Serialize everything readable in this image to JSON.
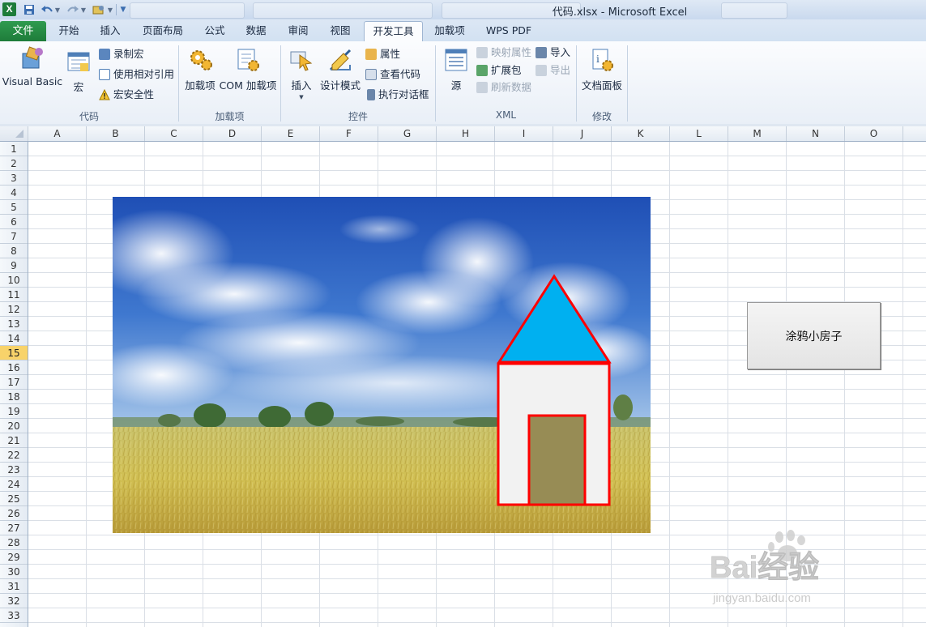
{
  "window": {
    "title": "代码.xlsx - Microsoft Excel"
  },
  "ribbon_tabs": [
    {
      "label": "文件"
    },
    {
      "label": "开始"
    },
    {
      "label": "插入"
    },
    {
      "label": "页面布局"
    },
    {
      "label": "公式"
    },
    {
      "label": "数据"
    },
    {
      "label": "审阅"
    },
    {
      "label": "视图"
    },
    {
      "label": "开发工具",
      "active": true
    },
    {
      "label": "加载项"
    },
    {
      "label": "WPS PDF"
    }
  ],
  "groups": {
    "code": {
      "label": "代码",
      "visual_basic": "Visual Basic",
      "macros": "宏",
      "record_macro": "录制宏",
      "use_relative_refs": "使用相对引用",
      "macro_security": "宏安全性"
    },
    "addins": {
      "label": "加载项",
      "addins_btn": "加载项",
      "com_addins": "COM 加载项"
    },
    "controls": {
      "label": "控件",
      "insert": "插入",
      "design_mode": "设计模式",
      "properties": "属性",
      "view_code": "查看代码",
      "run_dialog": "执行对话框"
    },
    "xml": {
      "label": "XML",
      "source": "源",
      "map_properties": "映射属性",
      "expansion_packs": "扩展包",
      "refresh_data": "刷新数据",
      "import": "导入",
      "export": "导出"
    },
    "modify": {
      "label": "修改",
      "document_panel": "文档面板"
    }
  },
  "sheet": {
    "columns": [
      "A",
      "B",
      "C",
      "D",
      "E",
      "F",
      "G",
      "H",
      "I",
      "J",
      "K",
      "L",
      "M",
      "N",
      "O"
    ],
    "rows": [
      "1",
      "2",
      "3",
      "4",
      "5",
      "6",
      "7",
      "8",
      "9",
      "10",
      "11",
      "12",
      "13",
      "14",
      "15",
      "16",
      "17",
      "18",
      "19",
      "20",
      "21",
      "22",
      "23",
      "24",
      "25",
      "26",
      "27",
      "28",
      "29",
      "30",
      "31",
      "32",
      "33"
    ],
    "active_row": "15",
    "macro_button_label": "涂鸦小房子"
  },
  "watermark": {
    "brand": "Bai经验",
    "url": "jingyan.baidu.com"
  },
  "colors": {
    "file_tab": "#1e7c3a",
    "roof_fill": "#00b0f0",
    "outline_red": "#ff0000",
    "door_fill": "#978c55",
    "house_fill": "#f2f2f2",
    "active_row_highlight": "#f8d36a"
  },
  "icons": {
    "excel": "excel-logo-icon",
    "save": "save-icon",
    "undo": "undo-icon",
    "redo": "redo-icon"
  }
}
